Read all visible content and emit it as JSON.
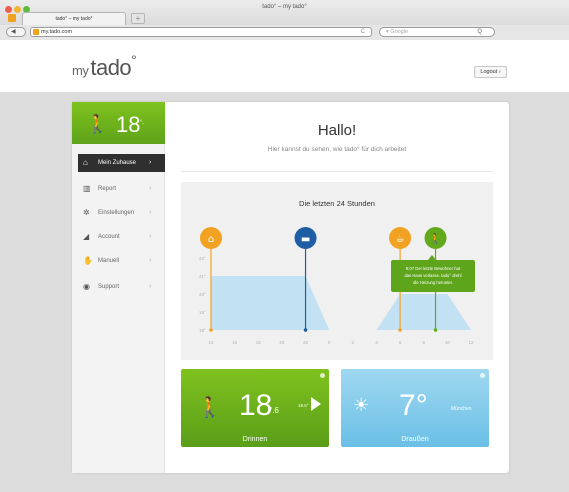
{
  "browser": {
    "window_title": "tado° – my tado°",
    "tab_label": "tado° – my tado°",
    "new_tab": "+",
    "back": "◀",
    "url": "my.tado.com",
    "reload": "C",
    "search_placeholder": "▾ Google",
    "search_go": "Q"
  },
  "header": {
    "logo_prefix": "my",
    "logo_main": "tado",
    "logo_degree": "°",
    "logout_label": "Logout ›"
  },
  "sidebar": {
    "status_temp": "18",
    "status_temp_dec": "°.",
    "items": [
      {
        "label": "Mein Zuhause",
        "icon": "home-icon",
        "glyph": "⌂",
        "chev": "›"
      },
      {
        "label": "Report",
        "icon": "bar-chart-icon",
        "glyph": "▥",
        "chev": "›"
      },
      {
        "label": "Einstellungen",
        "icon": "gear-icon",
        "glyph": "✲",
        "chev": "›"
      },
      {
        "label": "Account",
        "icon": "user-icon",
        "glyph": "◢",
        "chev": "›"
      },
      {
        "label": "Manuell",
        "icon": "hand-icon",
        "glyph": "✋",
        "chev": "›"
      },
      {
        "label": "Support",
        "icon": "support-icon",
        "glyph": "◉",
        "chev": "›"
      }
    ]
  },
  "main": {
    "greeting": "Hallo!",
    "subtitle": "Hier kannst du sehen, wie tado° für dich arbeitet"
  },
  "chart": {
    "title": "Die letzten 24 Stunden",
    "tooltip_lines": [
      "9:07 Der letzte Bewohner hat",
      "das Haus verlasse. tado° drehl",
      "die Heizung herunter."
    ]
  },
  "chart_data": {
    "type": "area",
    "title": "Die letzten 24 Stunden",
    "x_ticks": [
      "14",
      "16",
      "18",
      "20",
      "22",
      "0",
      "2",
      "4",
      "6",
      "8",
      "10",
      "12"
    ],
    "y_ticks": [
      "22°",
      "21°",
      "20°",
      "19°",
      "18°"
    ],
    "series": [
      {
        "x": [
          "14",
          "16",
          "18",
          "20",
          "22",
          "0",
          "2",
          "4",
          "6",
          "8",
          "10",
          "12"
        ],
        "values": [
          21,
          21,
          21,
          21,
          21,
          18,
          18,
          18,
          20,
          20,
          20,
          18
        ]
      }
    ],
    "events": [
      {
        "icon": "home-icon",
        "x": "14",
        "color": "#f2a222"
      },
      {
        "icon": "bed-icon",
        "x": "22",
        "color": "#1f5ea4"
      },
      {
        "icon": "coffee-icon",
        "x": "6",
        "color": "#f2a222"
      },
      {
        "icon": "walker-icon",
        "x": "9",
        "color": "#63a91c"
      }
    ],
    "colors": {
      "area": "#bde0f3",
      "home": "#f2a222",
      "bed": "#1f5ea4",
      "coffee": "#f2a222",
      "away": "#63a91c"
    }
  },
  "tiles": {
    "indoor": {
      "temp": "18",
      "temp_dec": "°.6",
      "target": "18.6°",
      "caption": "Drinnen"
    },
    "outdoor": {
      "temp": "7",
      "temp_dec": "°",
      "city": "München",
      "caption": "Draußen"
    }
  }
}
